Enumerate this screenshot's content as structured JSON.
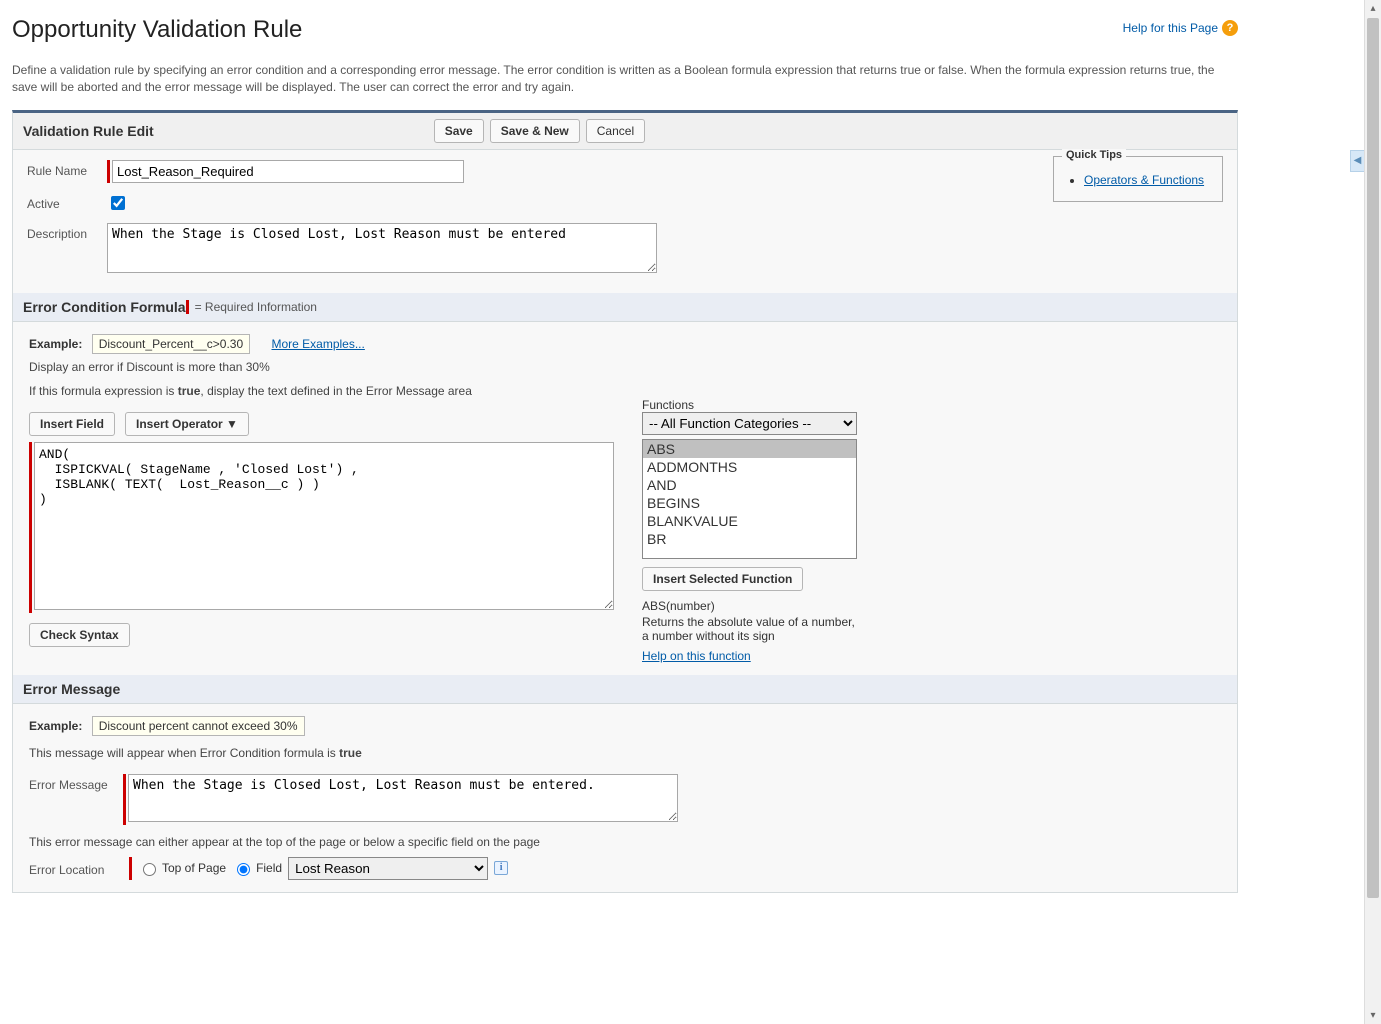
{
  "header": {
    "title": "Opportunity Validation Rule",
    "help_link": "Help for this Page",
    "intro": "Define a validation rule by specifying an error condition and a corresponding error message. The error condition is written as a Boolean formula expression that returns true or false. When the formula expression returns true, the save will be aborted and the error message will be displayed. The user can correct the error and try again."
  },
  "edit_section": {
    "title": "Validation Rule Edit",
    "buttons": {
      "save": "Save",
      "save_new": "Save & New",
      "cancel": "Cancel"
    },
    "labels": {
      "rule_name": "Rule Name",
      "active": "Active",
      "description": "Description"
    },
    "rule_name": "Lost_Reason_Required",
    "active": true,
    "description": "When the Stage is Closed Lost, Lost Reason must be entered",
    "quick_tips": {
      "title": "Quick Tips",
      "link": "Operators & Functions"
    }
  },
  "formula_section": {
    "title": "Error Condition Formula",
    "required_info": "= Required Information",
    "example_label": "Example:",
    "example_code": "Discount_Percent__c>0.30",
    "more_examples": "More Examples...",
    "example_desc": "Display an error if Discount is more than 30%",
    "instruction_pre": "If this formula expression is ",
    "instruction_bold": "true",
    "instruction_post": ", display the text defined in the Error Message area",
    "insert_field": "Insert Field",
    "insert_operator": "Insert Operator  ▼",
    "formula": "AND(\n  ISPICKVAL( StageName , 'Closed Lost') ,\n  ISBLANK( TEXT(  Lost_Reason__c ) )\n)",
    "check_syntax": "Check Syntax",
    "functions": {
      "label": "Functions",
      "category": "-- All Function Categories --",
      "list": [
        "ABS",
        "ADDMONTHS",
        "AND",
        "BEGINS",
        "BLANKVALUE",
        "BR"
      ],
      "selected": "ABS",
      "insert_btn": "Insert Selected Function",
      "signature": "ABS(number)",
      "description": "Returns the absolute value of a number, a number without its sign",
      "help": "Help on this function"
    }
  },
  "error_section": {
    "title": "Error Message",
    "example_label": "Example:",
    "example_code": "Discount percent cannot exceed 30%",
    "instruction_pre": "This message will appear when Error Condition formula is ",
    "instruction_bold": "true",
    "error_message_label": "Error Message",
    "error_message": "When the Stage is Closed Lost, Lost Reason must be entered.",
    "location_instruction": "This error message can either appear at the top of the page or below a specific field on the page",
    "error_location_label": "Error Location",
    "top_of_page": "Top of Page",
    "field_label": "Field",
    "field_value": "Lost Reason"
  }
}
